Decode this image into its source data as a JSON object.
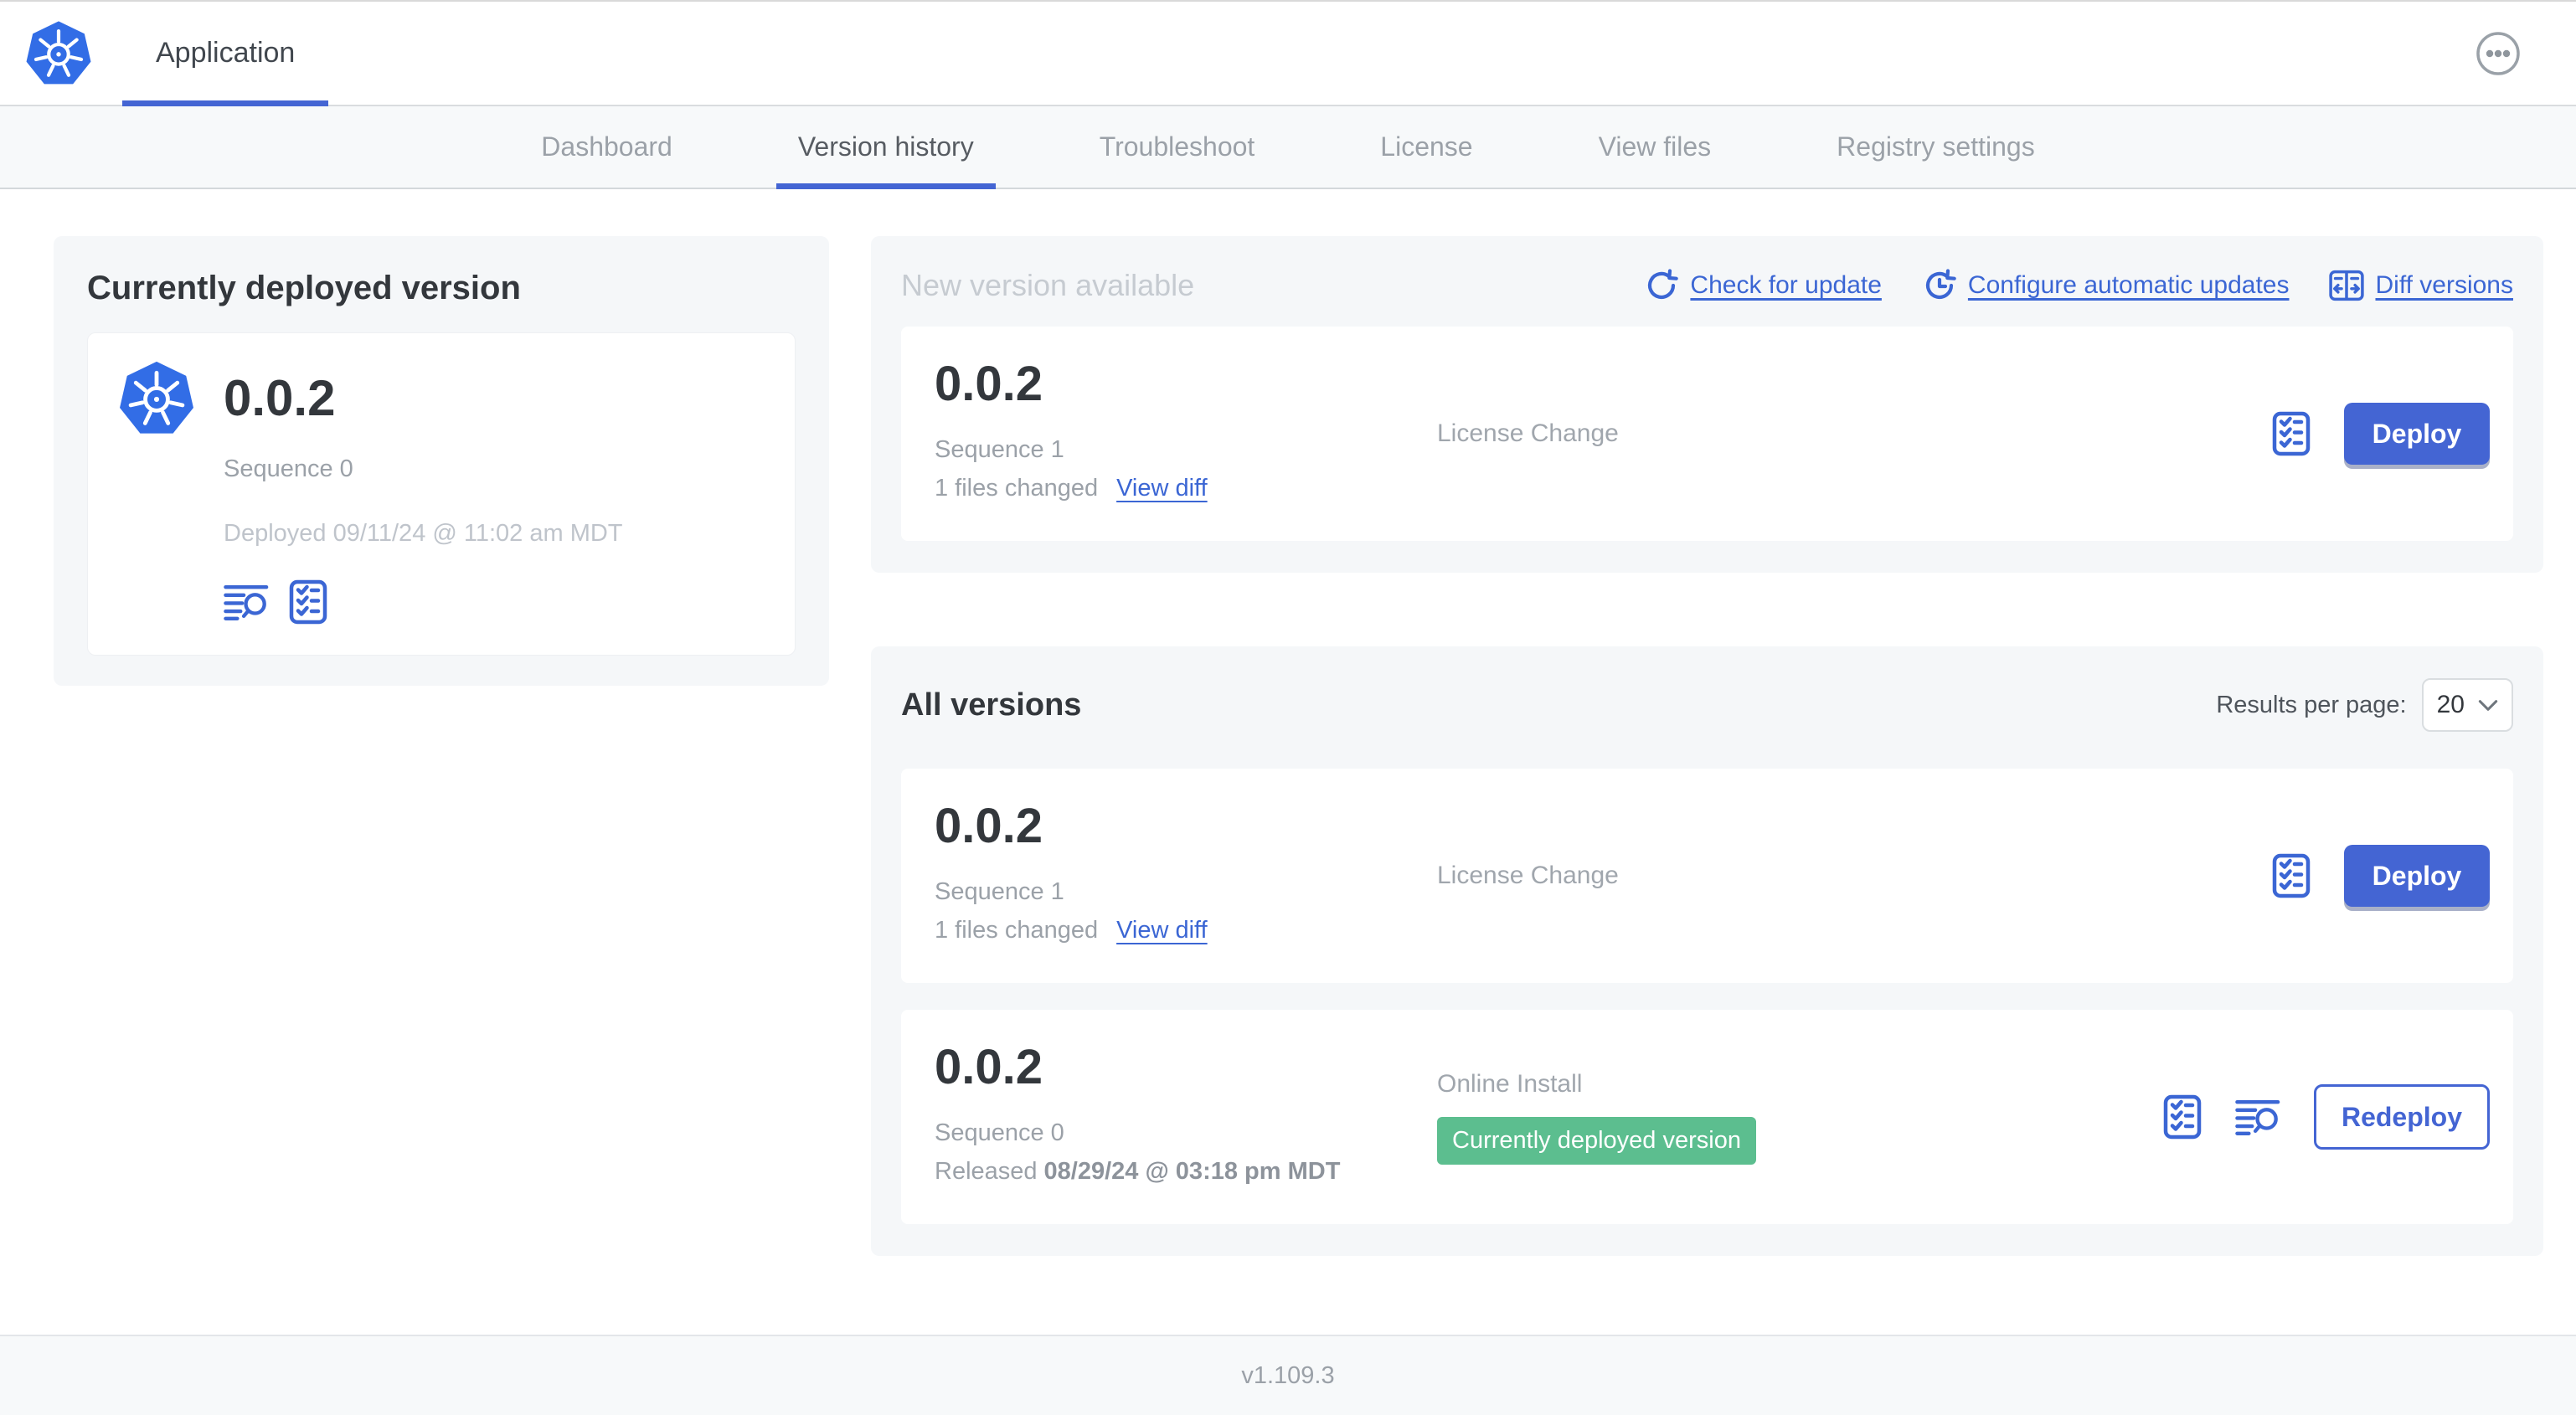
{
  "header": {
    "app_label": "Application"
  },
  "nav": {
    "tabs": [
      {
        "label": "Dashboard"
      },
      {
        "label": "Version history"
      },
      {
        "label": "Troubleshoot"
      },
      {
        "label": "License"
      },
      {
        "label": "View files"
      },
      {
        "label": "Registry settings"
      }
    ]
  },
  "current": {
    "title": "Currently deployed version",
    "version": "0.0.2",
    "sequence": "Sequence 0",
    "deployed_at": "Deployed 09/11/24 @ 11:02 am MDT"
  },
  "new_version": {
    "title": "New version available",
    "check_for_update": "Check for update",
    "configure_updates": "Configure automatic updates",
    "diff_versions": "Diff versions",
    "row": {
      "version": "0.0.2",
      "sequence": "Sequence 1",
      "files_changed": "1 files changed",
      "view_diff": "View diff",
      "source": "License Change",
      "action": "Deploy"
    }
  },
  "all_versions": {
    "title": "All versions",
    "results_per_page_label": "Results per page:",
    "results_per_page_value": "20",
    "rows": [
      {
        "version": "0.0.2",
        "sequence": "Sequence 1",
        "files_changed": "1 files changed",
        "view_diff": "View diff",
        "source": "License Change",
        "action": "Deploy"
      },
      {
        "version": "0.0.2",
        "sequence": "Sequence 0",
        "released_label": "Released",
        "released_date": "08/29/24 @ 03:18 pm MDT",
        "source": "Online Install",
        "badge": "Currently deployed version",
        "action": "Redeploy"
      }
    ]
  },
  "footer": {
    "app_version": "v1.109.3"
  },
  "colors": {
    "link_blue": "#3b66d4",
    "button_blue": "#4465d3",
    "badge_green": "#5cbe8f",
    "k8s_blue": "#326de6"
  }
}
